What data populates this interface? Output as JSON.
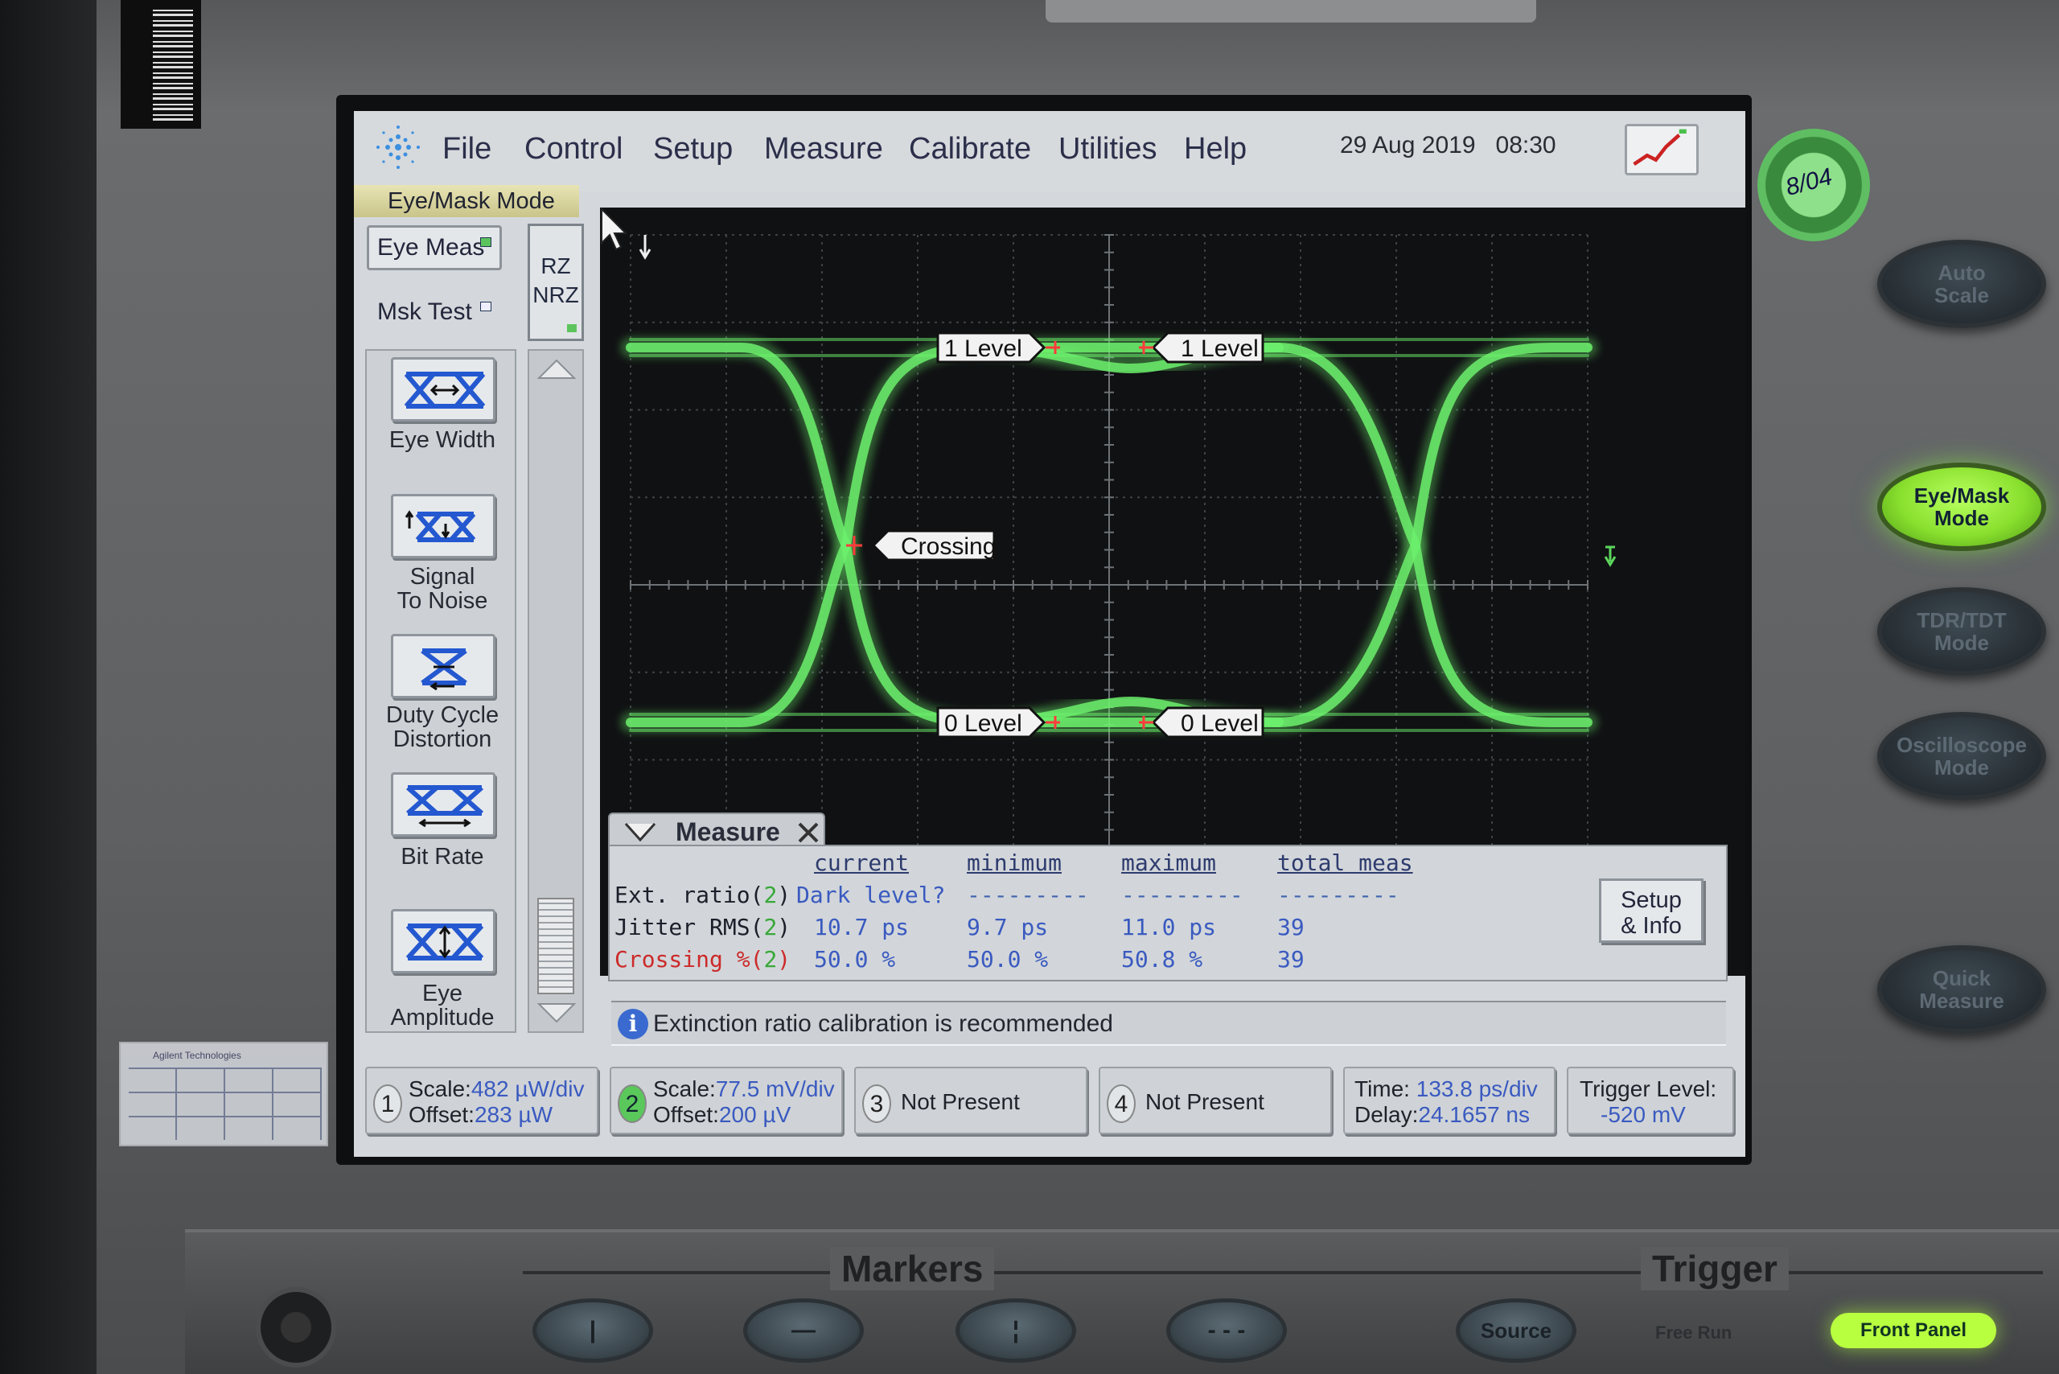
{
  "menu": {
    "items": [
      "File",
      "Control",
      "Setup",
      "Measure",
      "Calibrate",
      "Utilities",
      "Help"
    ],
    "date": "29 Aug 2019",
    "time": "08:30",
    "mode_label": "Eye/Mask Mode"
  },
  "toolbar": {
    "eye_meas": "Eye Meas",
    "msk_test": "Msk Test",
    "rz": "RZ",
    "nrz": "NRZ",
    "tools": [
      "Eye Width",
      "Signal\nTo Noise",
      "Duty Cycle\nDistortion",
      "Bit Rate",
      "Eye\nAmplitude"
    ]
  },
  "plot": {
    "markers": {
      "one_level_left": "1 Level",
      "one_level_right": "1 Level",
      "crossing": "Crossing",
      "zero_level_left": "0 Level",
      "zero_level_right": "0 Level"
    }
  },
  "measure": {
    "title": "Measure",
    "headers": [
      "current",
      "minimum",
      "maximum",
      "total meas"
    ],
    "rows": [
      {
        "name": "Ext. ratio(",
        "ch": "2",
        "close": ")",
        "current": "Dark level?",
        "minimum": "---------",
        "maximum": "---------",
        "total": "---------"
      },
      {
        "name": "Jitter RMS(",
        "ch": "2",
        "close": ")",
        "current": "10.7 ps",
        "minimum": "9.7 ps",
        "maximum": "11.0 ps",
        "total": "39"
      },
      {
        "name": "Crossing %(",
        "ch": "2",
        "close": ")",
        "current": "50.0 %",
        "minimum": "50.0 %",
        "maximum": "50.8 %",
        "total": "39"
      }
    ],
    "setup_info": "Setup\n& Info"
  },
  "info": {
    "icon": "i",
    "message": "Extinction ratio calibration is recommended"
  },
  "channels": {
    "ch1": {
      "num": "1",
      "scale_label": "Scale:",
      "scale": "482 µW/div",
      "offset_label": "Offset:",
      "offset": "283 µW"
    },
    "ch2": {
      "num": "2",
      "scale_label": "Scale:",
      "scale": "77.5 mV/div",
      "offset_label": "Offset:",
      "offset": "200 µV"
    },
    "ch3": {
      "num": "3",
      "status": "Not Present"
    },
    "ch4": {
      "num": "4",
      "status": "Not Present"
    },
    "time": {
      "time_label": "Time:",
      "time": "133.8 ps/div",
      "delay_label": "Delay:",
      "delay": "24.1657 ns"
    },
    "trigger": {
      "label": "Trigger Level:",
      "value": "-520 mV"
    }
  },
  "hardware": {
    "right_buttons": [
      "Auto\nScale",
      "Eye/Mask\nMode",
      "TDR/TDT\nMode",
      "Oscilloscope\nMode",
      "Quick\nMeasure"
    ],
    "markers_title": "Markers",
    "trigger_title": "Trigger",
    "marker_buttons": [
      "|",
      "—",
      "¦",
      "- - -"
    ],
    "source": "Source",
    "free_run": "Free Run",
    "front_panel": "Front Panel",
    "sticker": "8/04"
  },
  "colors": {
    "trace": "#6cf06c",
    "marker_red": "#ff3b3b",
    "accent_green": "#b8ff40"
  }
}
